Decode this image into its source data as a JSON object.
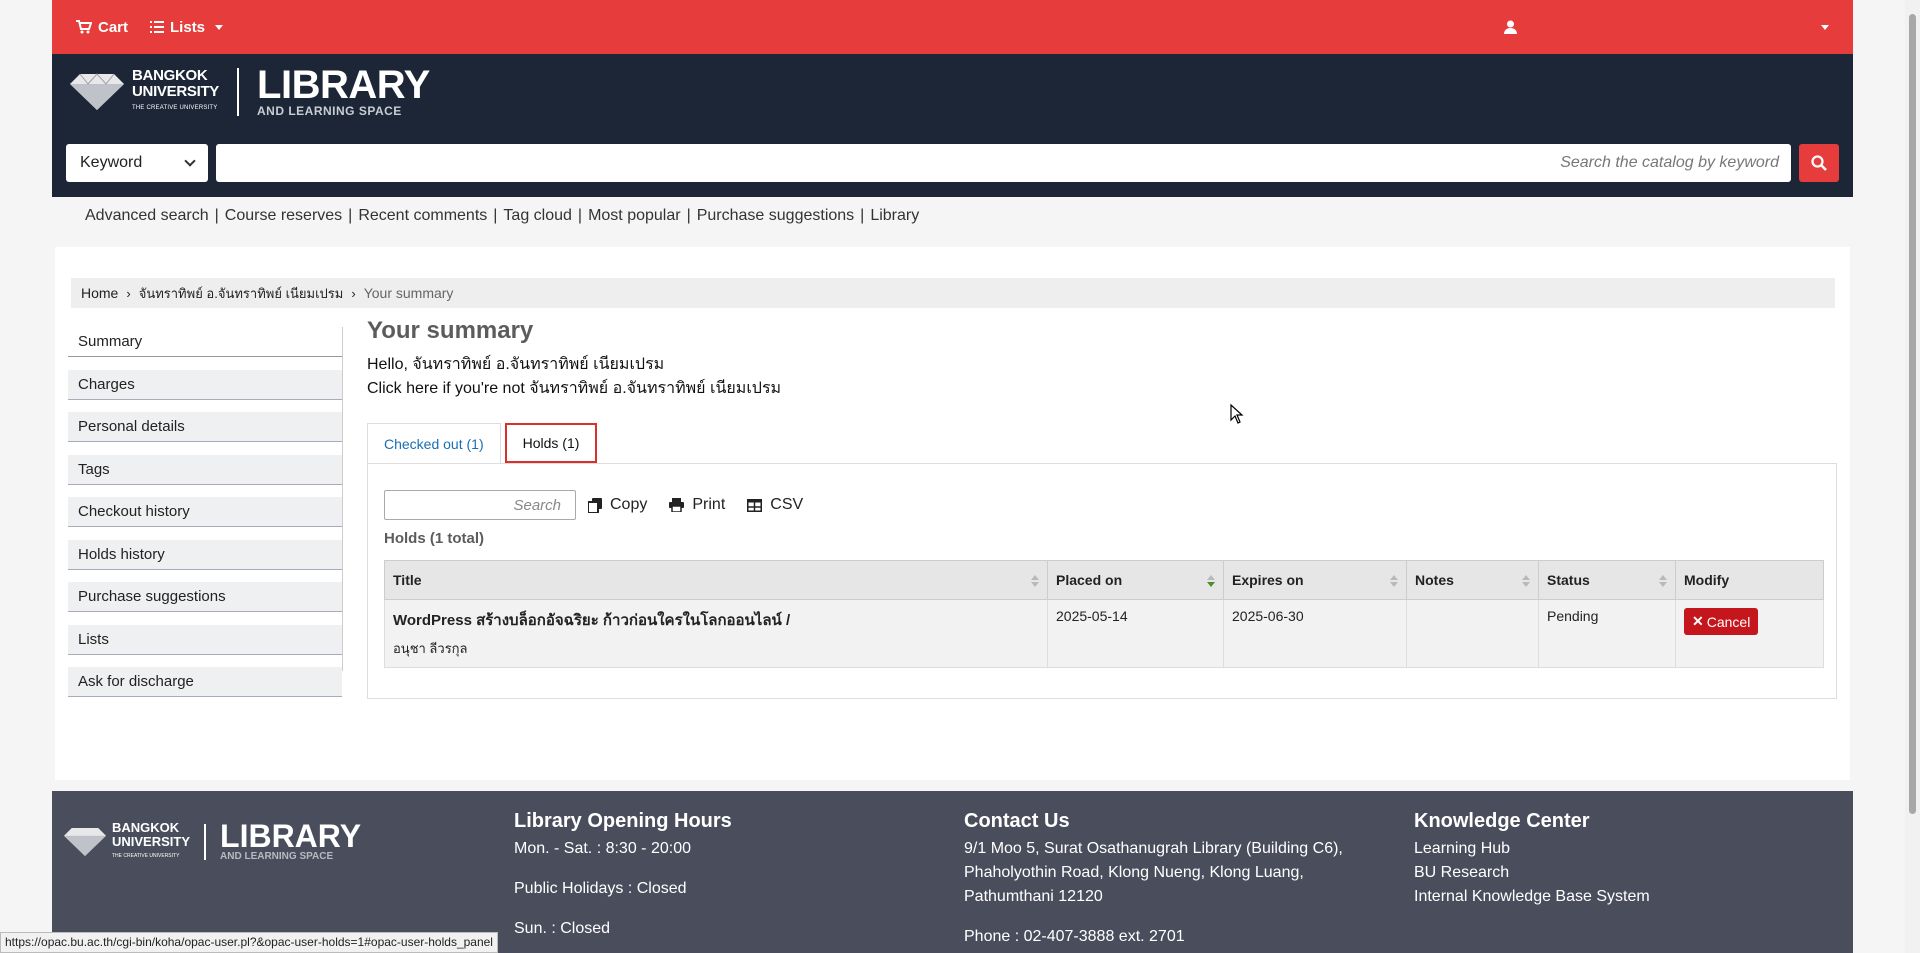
{
  "topbar": {
    "cart": "Cart",
    "lists": "Lists"
  },
  "masthead": {
    "bu_line1": "BANGKOK",
    "bu_line2": "UNIVERSITY",
    "bu_tagline": "THE CREATIVE UNIVERSITY",
    "library": "LIBRARY",
    "library_sub": "AND LEARNING SPACE"
  },
  "search": {
    "type": "Keyword",
    "placeholder": "Search the catalog by keyword"
  },
  "links": [
    "Advanced search",
    "Course reserves",
    "Recent comments",
    "Tag cloud",
    "Most popular",
    "Purchase suggestions",
    "Library"
  ],
  "breadcrumb": {
    "home": "Home",
    "user": "จันทราทิพย์ อ.จันทราทิพย์ เนียมเปรม",
    "current": "Your summary"
  },
  "sidenav": [
    "Summary",
    "Charges",
    "Personal details",
    "Tags",
    "Checkout history",
    "Holds history",
    "Purchase suggestions",
    "Lists",
    "Ask for discharge"
  ],
  "summary": {
    "title": "Your summary",
    "hello": "Hello, จันทราทิพย์ อ.จันทราทิพย์ เนียมเปรม",
    "notyou": "Click here if you're not จันทราทิพย์ อ.จันทราทิพย์ เนียมเปรม"
  },
  "tabs": {
    "checked_out": "Checked out (1)",
    "holds": "Holds (1)"
  },
  "toolbar": {
    "search_placeholder": "Search",
    "copy": "Copy",
    "print": "Print",
    "csv": "CSV"
  },
  "holds": {
    "total": "Holds (1 total)",
    "columns": [
      "Title",
      "Placed on",
      "Expires on",
      "Notes",
      "Status",
      "Modify"
    ],
    "rows": [
      {
        "title": "WordPress สร้างบล็อกอัจฉริยะ ก้าวก่อนใครในโลกออนไลน์ /",
        "author": "อนุชา ลีวรกุล",
        "placed_on": "2025-05-14",
        "expires_on": "2025-06-30",
        "notes": "",
        "status": "Pending",
        "cancel": "Cancel"
      }
    ]
  },
  "footer": {
    "hours_title": "Library Opening Hours",
    "hours": [
      "Mon. - Sat. : 8:30 - 20:00",
      "Public Holidays : Closed",
      "Sun. : Closed"
    ],
    "contact_title": "Contact Us",
    "contact": [
      "9/1 Moo 5, Surat Osathanugrah Library (Building C6),",
      "Phaholyothin Road, Klong Nueng, Klong Luang,",
      "Pathumthani 12120"
    ],
    "phone": "Phone : 02-407-3888 ext. 2701",
    "knowledge_title": "Knowledge Center",
    "knowledge": [
      "Learning Hub",
      "BU Research",
      "Internal Knowledge Base System"
    ]
  },
  "status_url": "https://opac.bu.ac.th/cgi-bin/koha/opac-user.pl?&opac-user-holds=1#opac-user-holds_panel",
  "colors": {
    "brand_red": "#e63c3c",
    "masthead": "#1d2636",
    "footer": "#4a4e5c",
    "link_blue": "#1a6fb3",
    "cancel_red": "#c4161c"
  }
}
